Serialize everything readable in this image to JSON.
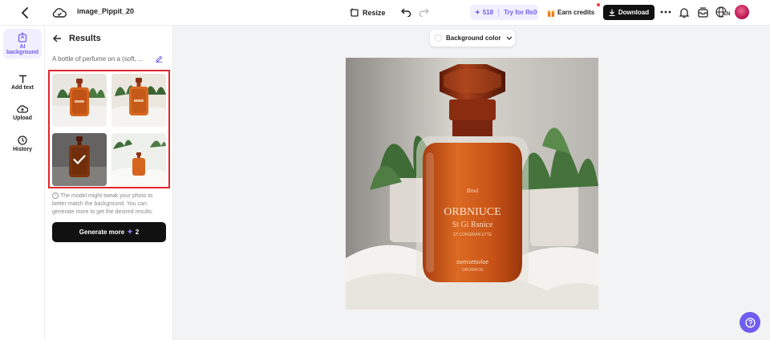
{
  "topbar": {
    "file_name": "image_Pippit_20",
    "resize_label": "Resize",
    "credits_count": "518",
    "credits_cta": "Try for ₨0",
    "earn_label": "Earn credits",
    "download_label": "Download",
    "lang_code": "EN"
  },
  "rail": {
    "items": [
      {
        "label": "AI background",
        "icon": "ai-background-icon",
        "active": true
      },
      {
        "label": "Add text",
        "icon": "text-icon"
      },
      {
        "label": "Upload",
        "icon": "upload-icon"
      },
      {
        "label": "History",
        "icon": "history-icon"
      }
    ]
  },
  "panel": {
    "title": "Results",
    "prompt": "A bottle of perfume on a (soft, ...",
    "note": "The model might tweak your photo to better match the background. You can generate more to get the desired results.",
    "generate_label": "Generate more",
    "generate_cost": "2",
    "thumbnails": [
      {
        "name": "result-1",
        "selected": false
      },
      {
        "name": "result-2",
        "selected": false
      },
      {
        "name": "result-3",
        "selected": true
      },
      {
        "name": "result-4",
        "selected": false
      }
    ]
  },
  "canvas": {
    "bg_color_label": "Background color",
    "label_line1": "Brnd",
    "label_line2": "ORBNIUCE",
    "label_line3": "St Gi Rsnice",
    "label_line4": "ST CORGBIAN ETTE",
    "label_line5": "swmsetsvloe",
    "label_line6": "OROWAOS"
  },
  "colors": {
    "accent": "#6f5cf1",
    "highlight_border": "#e2262d",
    "button_dark": "#111111",
    "perfume": "#c2521a"
  }
}
